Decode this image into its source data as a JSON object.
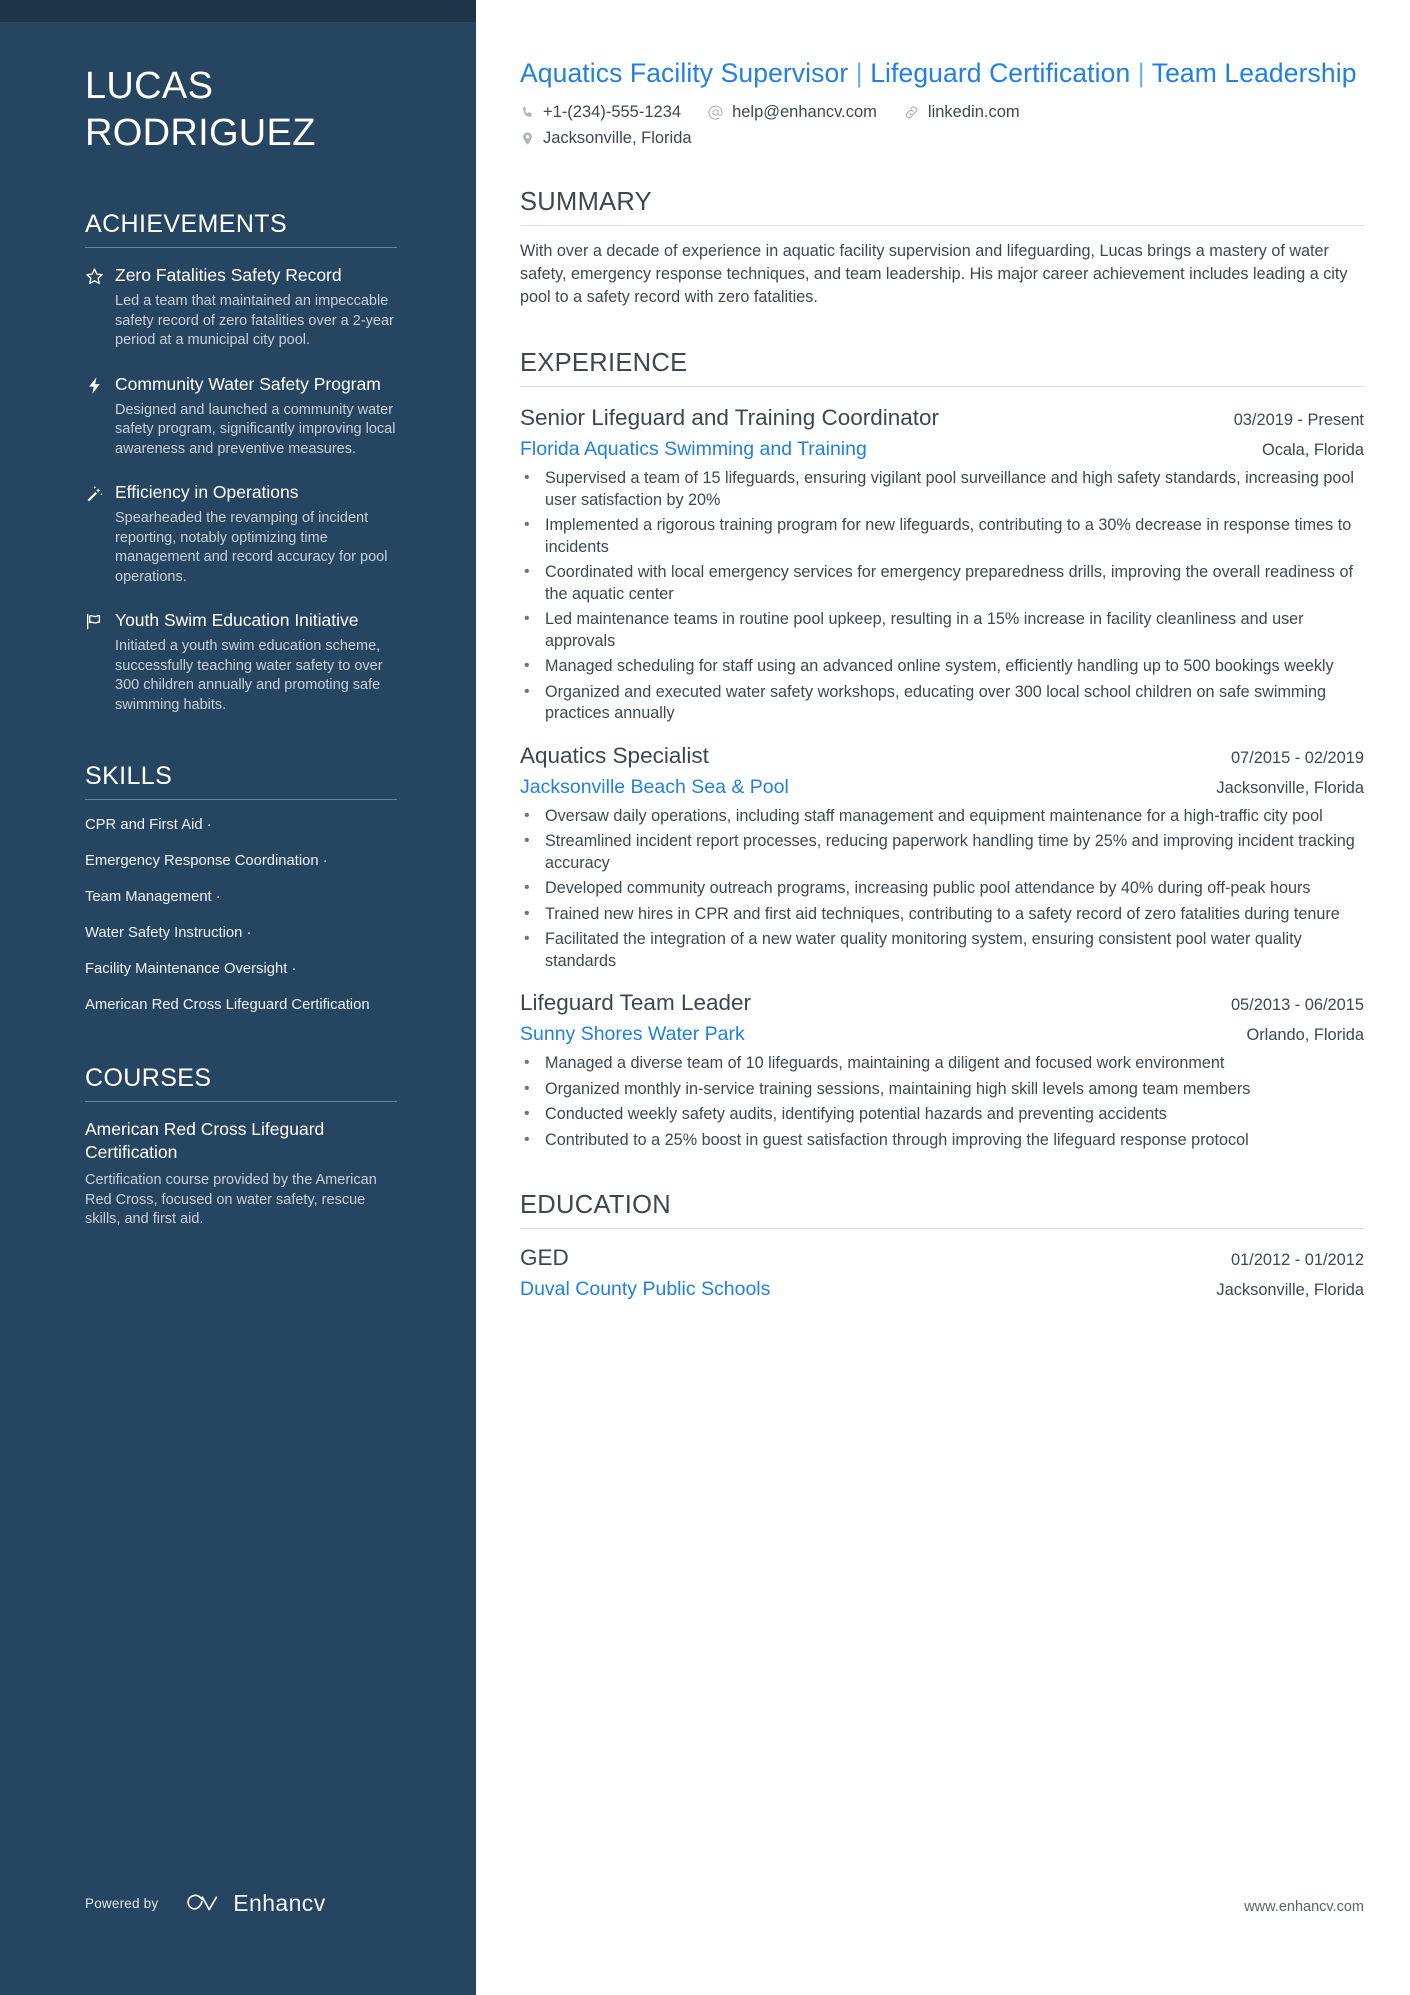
{
  "sidebar": {
    "name": "LUCAS RODRIGUEZ",
    "achievements": {
      "heading": "ACHIEVEMENTS",
      "items": [
        {
          "icon": "star-icon",
          "title": "Zero Fatalities Safety Record",
          "description": "Led a team that maintained an impeccable safety record of zero fatalities over a 2-year period at a municipal city pool."
        },
        {
          "icon": "lightning-bolt-icon",
          "title": "Community Water Safety Program",
          "description": "Designed and launched a community water safety program, significantly improving local awareness and preventive measures."
        },
        {
          "icon": "magic-wand-icon",
          "title": "Efficiency in Operations",
          "description": "Spearheaded the revamping of incident reporting, notably optimizing time management and record accuracy for pool operations."
        },
        {
          "icon": "flag-icon",
          "title": "Youth Swim Education Initiative",
          "description": "Initiated a youth swim education scheme, successfully teaching water safety to over 300 children annually and promoting safe swimming habits."
        }
      ]
    },
    "skills": {
      "heading": "SKILLS",
      "separator": "·",
      "items": [
        "CPR and First Aid",
        "Emergency Response Coordination",
        "Team Management",
        "Water Safety Instruction",
        "Facility Maintenance Oversight",
        "American Red Cross Lifeguard Certification"
      ]
    },
    "courses": {
      "heading": "COURSES",
      "items": [
        {
          "title": "American Red Cross Lifeguard Certification",
          "description": "Certification course provided by the American Red Cross, focused on water safety, rescue skills, and first aid."
        }
      ]
    },
    "footer": {
      "powered_by": "Powered by",
      "brand": "Enhancv",
      "logo_icon": "enhancv-infinity-logo"
    }
  },
  "main": {
    "headline": {
      "part1": "Aquatics Facility Supervisor",
      "divider1": "|",
      "part2": "Lifeguard Certification",
      "divider2": "|",
      "part3": "Team Leadership"
    },
    "contact": {
      "phone": "+1-(234)-555-1234",
      "email": "help@enhancv.com",
      "linkedin": "linkedin.com",
      "location": "Jacksonville, Florida",
      "icons": {
        "phone": "phone-icon",
        "email": "at-sign-icon",
        "linkedin": "link-icon",
        "location": "map-pin-icon"
      }
    },
    "summary": {
      "heading": "SUMMARY",
      "text": "With over a decade of experience in aquatic facility supervision and lifeguarding, Lucas brings a mastery of water safety, emergency response techniques, and team leadership. His major career achievement includes leading a city pool to a safety record with zero fatalities."
    },
    "experience": {
      "heading": "EXPERIENCE",
      "jobs": [
        {
          "title": "Senior Lifeguard and Training Coordinator",
          "dates": "03/2019 - Present",
          "company": "Florida Aquatics Swimming and Training",
          "location": "Ocala, Florida",
          "bullets": [
            "Supervised a team of 15 lifeguards, ensuring vigilant pool surveillance and high safety standards, increasing pool user satisfaction by 20%",
            "Implemented a rigorous training program for new lifeguards, contributing to a 30% decrease in response times to incidents",
            "Coordinated with local emergency services for emergency preparedness drills, improving the overall readiness of the aquatic center",
            "Led maintenance teams in routine pool upkeep, resulting in a 15% increase in facility cleanliness and user approvals",
            "Managed scheduling for staff using an advanced online system, efficiently handling up to 500 bookings weekly",
            "Organized and executed water safety workshops, educating over 300 local school children on safe swimming practices annually"
          ]
        },
        {
          "title": "Aquatics Specialist",
          "dates": "07/2015 - 02/2019",
          "company": "Jacksonville Beach Sea & Pool",
          "location": "Jacksonville, Florida",
          "bullets": [
            "Oversaw daily operations, including staff management and equipment maintenance for a high-traffic city pool",
            "Streamlined incident report processes, reducing paperwork handling time by 25% and improving incident tracking accuracy",
            "Developed community outreach programs, increasing public pool attendance by 40% during off-peak hours",
            "Trained new hires in CPR and first aid techniques, contributing to a safety record of zero fatalities during tenure",
            "Facilitated the integration of a new water quality monitoring system, ensuring consistent pool water quality standards"
          ]
        },
        {
          "title": "Lifeguard Team Leader",
          "dates": "05/2013 - 06/2015",
          "company": "Sunny Shores Water Park",
          "location": "Orlando, Florida",
          "bullets": [
            "Managed a diverse team of 10 lifeguards, maintaining a diligent and focused work environment",
            "Organized monthly in-service training sessions, maintaining high skill levels among team members",
            "Conducted weekly safety audits, identifying potential hazards and preventing accidents",
            "Contributed to a 25% boost in guest satisfaction through improving the lifeguard response protocol"
          ]
        }
      ]
    },
    "education": {
      "heading": "EDUCATION",
      "entries": [
        {
          "degree": "GED",
          "dates": "01/2012 - 01/2012",
          "school": "Duval County Public Schools",
          "location": "Jacksonville, Florida"
        }
      ]
    },
    "footer_url": "www.enhancv.com"
  },
  "colors": {
    "sidebar_bg": "#264560",
    "sidebar_top_bar": "#1d3449",
    "accent_link": "#2081e2",
    "body_text": "#3d4852",
    "muted_text": "#c7d1da"
  }
}
